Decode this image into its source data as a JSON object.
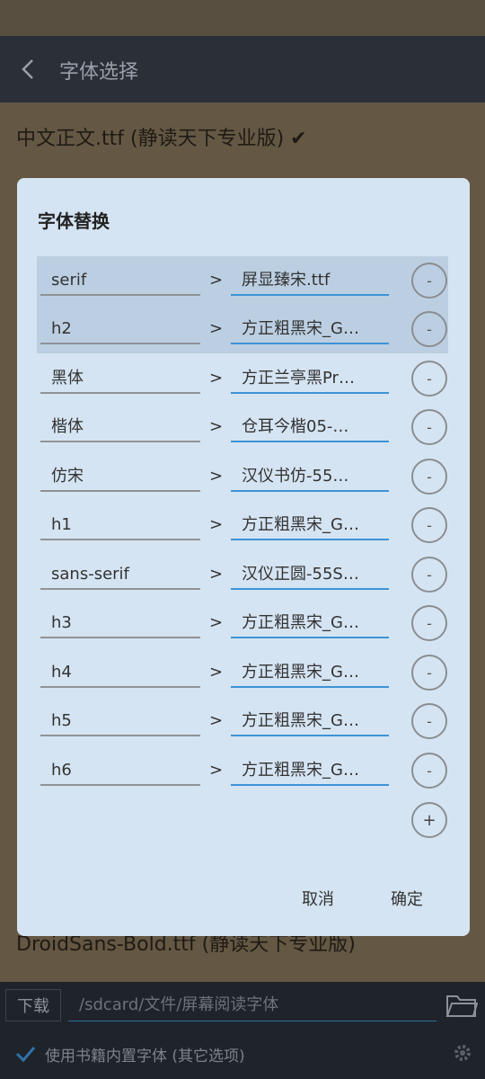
{
  "appbar": {
    "title": "字体选择"
  },
  "background": {
    "line1": "中文正文.ttf (静读天下专业版) ✔",
    "line2": "DroidSans-Bold.ttf (静读天下专业版)"
  },
  "bottombar": {
    "download_label": "下载",
    "path": "/sdcard/文件/屏幕阅读字体",
    "builtin_label": "使用书籍内置字体 (其它选项)"
  },
  "dialog": {
    "title": "字体替换",
    "arrow": ">",
    "remove_symbol": "-",
    "add_symbol": "+",
    "rows": [
      {
        "from": "serif",
        "to": "屏显臻宋.ttf"
      },
      {
        "from": "h2",
        "to": "方正粗黑宋_G…"
      },
      {
        "from": "黑体",
        "to": "方正兰亭黑Pr…"
      },
      {
        "from": "楷体",
        "to": "仓耳今楷05-…"
      },
      {
        "from": "仿宋",
        "to": "汉仪书仿-55…"
      },
      {
        "from": "h1",
        "to": "方正粗黑宋_G…"
      },
      {
        "from": "sans-serif",
        "to": "汉仪正圆-55S…"
      },
      {
        "from": "h3",
        "to": "方正粗黑宋_G…"
      },
      {
        "from": "h4",
        "to": "方正粗黑宋_G…"
      },
      {
        "from": "h5",
        "to": "方正粗黑宋_G…"
      },
      {
        "from": "h6",
        "to": "方正粗黑宋_G…"
      }
    ],
    "cancel_label": "取消",
    "ok_label": "确定"
  },
  "colors": {
    "dialog_bg": "#d5e4f2",
    "selected_row": "#bccfe2",
    "accent_underline": "#3d93d6",
    "appbar_bg": "#2a2f38"
  }
}
